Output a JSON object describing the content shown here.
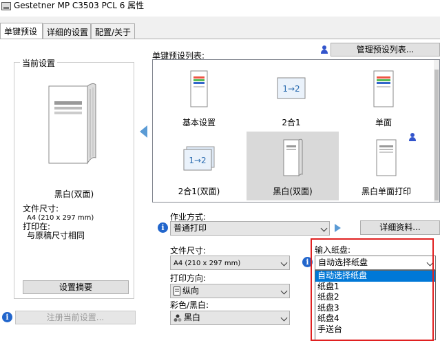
{
  "window": {
    "title": "Gestetner MP C3503 PCL 6 属性"
  },
  "tabs": [
    {
      "label": "单键预设",
      "active": true
    },
    {
      "label": "详细的设置",
      "active": false
    },
    {
      "label": "配置/关于",
      "active": false
    }
  ],
  "current_settings": {
    "legend": "当前设置",
    "preset_name": "黑白(双面)",
    "doc_size_label": "文件尺寸:",
    "doc_size_value": "A4 (210 x 297 mm)",
    "print_on_label": "打印在:",
    "print_on_value": "与原稿尺寸相同",
    "summary_button": "设置摘要",
    "register_button": "注册当前设置..."
  },
  "presets": {
    "list_label": "单键预设列表:",
    "manage_button": "管理预设列表...",
    "items": [
      {
        "label": "基本设置",
        "icon": "color-document-icon",
        "selected": false,
        "user": false
      },
      {
        "label": "2合1",
        "icon": "two-in-one-icon",
        "selected": false,
        "user": false
      },
      {
        "label": "单面",
        "icon": "color-document-icon",
        "selected": false,
        "user": false
      },
      {
        "label": "2合1(双面)",
        "icon": "two-in-one-duplex-icon",
        "selected": false,
        "user": false
      },
      {
        "label": "黑白(双面)",
        "icon": "bw-duplex-document-icon",
        "selected": true,
        "user": false
      },
      {
        "label": "黑白单面打印",
        "icon": "bw-document-icon",
        "selected": false,
        "user": true
      }
    ]
  },
  "job": {
    "label": "作业方式:",
    "value": "普通打印",
    "details_button": "详细资料..."
  },
  "doc_size": {
    "label": "文件尺寸:",
    "value": "A4 (210 x 297 mm)"
  },
  "orientation": {
    "label": "打印方向:",
    "value": "纵向"
  },
  "color_mode": {
    "label": "彩色/黑白:",
    "value": "黑白"
  },
  "input_tray": {
    "label": "输入纸盘:",
    "value": "自动选择纸盘",
    "options": [
      "自动选择纸盘",
      "纸盘1",
      "纸盘2",
      "纸盘3",
      "纸盘4",
      "手送台"
    ],
    "highlighted": "自动选择纸盘"
  },
  "colors": {
    "accent": "#0078d7",
    "highlight_box": "#e02020",
    "info": "#2266cc"
  }
}
